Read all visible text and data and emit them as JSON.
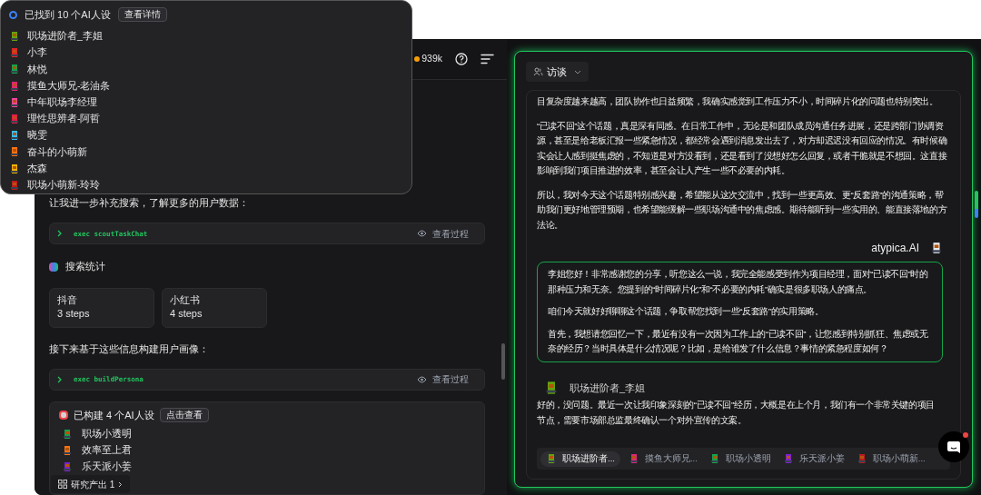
{
  "search_popover": {
    "title": "已找到 10 个AI人设",
    "button": "查看详情",
    "personas": [
      {
        "name": "职场进阶者_李姐",
        "color": "#65a30d"
      },
      {
        "name": "小李",
        "color": "#dc2626"
      },
      {
        "name": "林悦",
        "color": "#16a34a"
      },
      {
        "name": "摸鱼大师兄-老油条",
        "color": "#db2777"
      },
      {
        "name": "中年职场李经理",
        "color": "#ec4899"
      },
      {
        "name": "理性思辨者-阿哲",
        "color": "#e11d48"
      },
      {
        "name": "晓雯",
        "color": "#38bdf8"
      },
      {
        "name": "奋斗的小萌新",
        "color": "#f97316"
      },
      {
        "name": "杰森",
        "color": "#eab308"
      },
      {
        "name": "职场小萌新-玲玲",
        "color": "#b91c1c"
      }
    ]
  },
  "header": {
    "credits": "939k"
  },
  "feed": [
    {
      "kind": "text",
      "text": "让我进一步补充搜索，了解更多的用户数据："
    },
    {
      "kind": "exec",
      "command": "exec scoutTaskChat",
      "action": "查看过程"
    },
    {
      "kind": "heading",
      "text": "搜索统计"
    },
    {
      "kind": "stats",
      "items": [
        {
          "platform": "抖音",
          "steps": "3 steps"
        },
        {
          "platform": "小红书",
          "steps": "4 steps"
        }
      ]
    },
    {
      "kind": "text",
      "text": "接下来基于这些信息构建用户画像："
    },
    {
      "kind": "exec",
      "command": "exec buildPersona",
      "action": "查看过程"
    },
    {
      "kind": "personas",
      "title": "已构建 4 个AI人设",
      "button": "点击查看",
      "items": [
        {
          "name": "职场小透明",
          "color": "#16a34a"
        },
        {
          "name": "效率至上君",
          "color": "#f97316"
        },
        {
          "name": "乐天派小姜",
          "color": "#7e22ce"
        }
      ]
    }
  ],
  "output_button": {
    "label": "研究产出",
    "count": "1"
  },
  "interview": {
    "mode": "访谈",
    "messages": [
      {
        "kind": "user",
        "paragraphs": [
          "目复杂度越来越高，团队协作也日益频繁，我确实感觉到工作压力不小，时间碎片化的问题也特别突出。",
          "“已读不回”这个话题，真是深有同感。在日常工作中，无论是和团队成员沟通任务进展，还是跨部门协调资源，甚至是给老板汇报一些紧急情况，都经常会遇到消息发出去了，对方却迟迟没有回应的情况。有时候确实会让人感到挺焦虑的，不知道是对方没看到，还是看到了没想好怎么回复，或者干脆就是不想回。这直接影响到我们项目推进的效率，甚至会让人产生一些不必要的内耗。",
          "所以，我对今天这个话题特别感兴趣，希望能从这次交流中，找到一些更高效、更“反套路”的沟通策略，帮助我们更好地管理预期，也希望能缓解一些职场沟通中的焦虑感。期待能听到一些实用的、能直接落地的方法论。"
        ]
      },
      {
        "kind": "ai",
        "sender": "atypica.AI",
        "paragraphs": [
          "李姐您好！非常感谢您的分享，听您这么一说，我完全能感受到作为项目经理，面对“已读不回”时的那种压力和无奈。您提到的“时间碎片化”和“不必要的内耗”确实是很多职场人的痛点。",
          "咱们今天就好好聊聊这个话题，争取帮您找到一些“反套路”的实用策略。",
          "首先，我想请您回忆一下，最近有没有一次因为工作上的“已读不回”，让您感到特别抓狂、焦虑或无奈的经历？当时具体是什么情况呢？比如，是给谁发了什么信息？事情的紧急程度如何？"
        ]
      },
      {
        "kind": "persona",
        "name": "职场进阶者_李姐",
        "color": "#65a30d",
        "paragraphs": [
          "好的，没问题。最近一次让我印象深刻的“已读不回”经历，大概是在上个月，我们有一个非常关键的项目节点，需要市场部总监最终确认一个对外宣传的文案。"
        ]
      }
    ],
    "persona_tabs": [
      {
        "name": "职场进阶者...",
        "selected": true,
        "color": "#65a30d"
      },
      {
        "name": "摸鱼大师兄...",
        "selected": false,
        "color": "#db2777"
      },
      {
        "name": "职场小透明",
        "selected": false,
        "color": "#16a34a"
      },
      {
        "name": "乐天派小姜",
        "selected": false,
        "color": "#7e22ce"
      },
      {
        "name": "职场小萌新...",
        "selected": false,
        "color": "#b91c1c"
      }
    ]
  }
}
